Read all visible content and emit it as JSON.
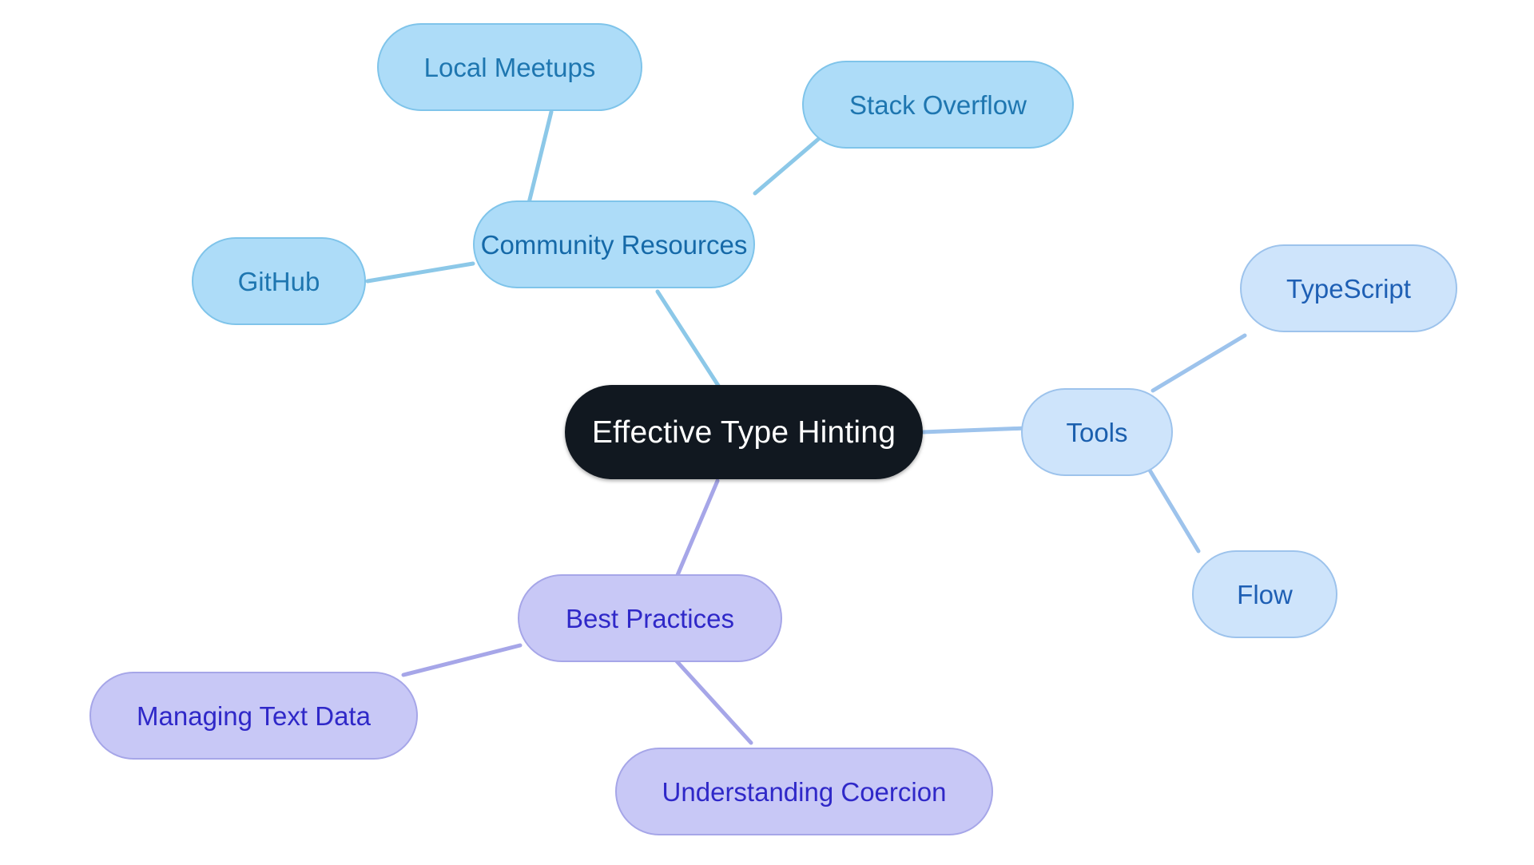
{
  "diagram": {
    "type": "mindmap",
    "title": "Effective Type Hinting",
    "background": "#ffffff",
    "palette": {
      "root_fill": "#111820",
      "root_text": "#ffffff",
      "blue_fill": "#ADDCF8",
      "blue_border": "#7FC4EA",
      "blue_text": "#1569A8",
      "blue_edge": "#8CC8E8",
      "ltblue_fill": "#CEE4FB",
      "ltblue_border": "#9DC3EC",
      "ltblue_text": "#1B5FAE",
      "ltblue_edge": "#9DC3EC",
      "purple_fill": "#C8C8F6",
      "purple_border": "#A6A6E8",
      "purple_text": "#2F28C8",
      "purple_edge": "#A6A6E8"
    }
  },
  "nodes": {
    "root": {
      "label": "Effective Type Hinting"
    },
    "community": {
      "label": "Community Resources"
    },
    "local_meetups": {
      "label": "Local Meetups"
    },
    "stack_overflow": {
      "label": "Stack Overflow"
    },
    "github": {
      "label": "GitHub"
    },
    "tools": {
      "label": "Tools"
    },
    "typescript": {
      "label": "TypeScript"
    },
    "flow": {
      "label": "Flow"
    },
    "best_practices": {
      "label": "Best Practices"
    },
    "managing_text_data": {
      "label": "Managing Text Data"
    },
    "understanding_coercion": {
      "label": "Understanding Coercion"
    }
  },
  "chart_data": {
    "type": "mindmap",
    "title": "Effective Type Hinting",
    "root": "Effective Type Hinting",
    "branches": [
      {
        "name": "Community Resources",
        "color": "#ADDCF8",
        "children": [
          "Local Meetups",
          "Stack Overflow",
          "GitHub"
        ]
      },
      {
        "name": "Tools",
        "color": "#CEE4FB",
        "children": [
          "TypeScript",
          "Flow"
        ]
      },
      {
        "name": "Best Practices",
        "color": "#C8C8F6",
        "children": [
          "Managing Text Data",
          "Understanding Coercion"
        ]
      }
    ]
  }
}
